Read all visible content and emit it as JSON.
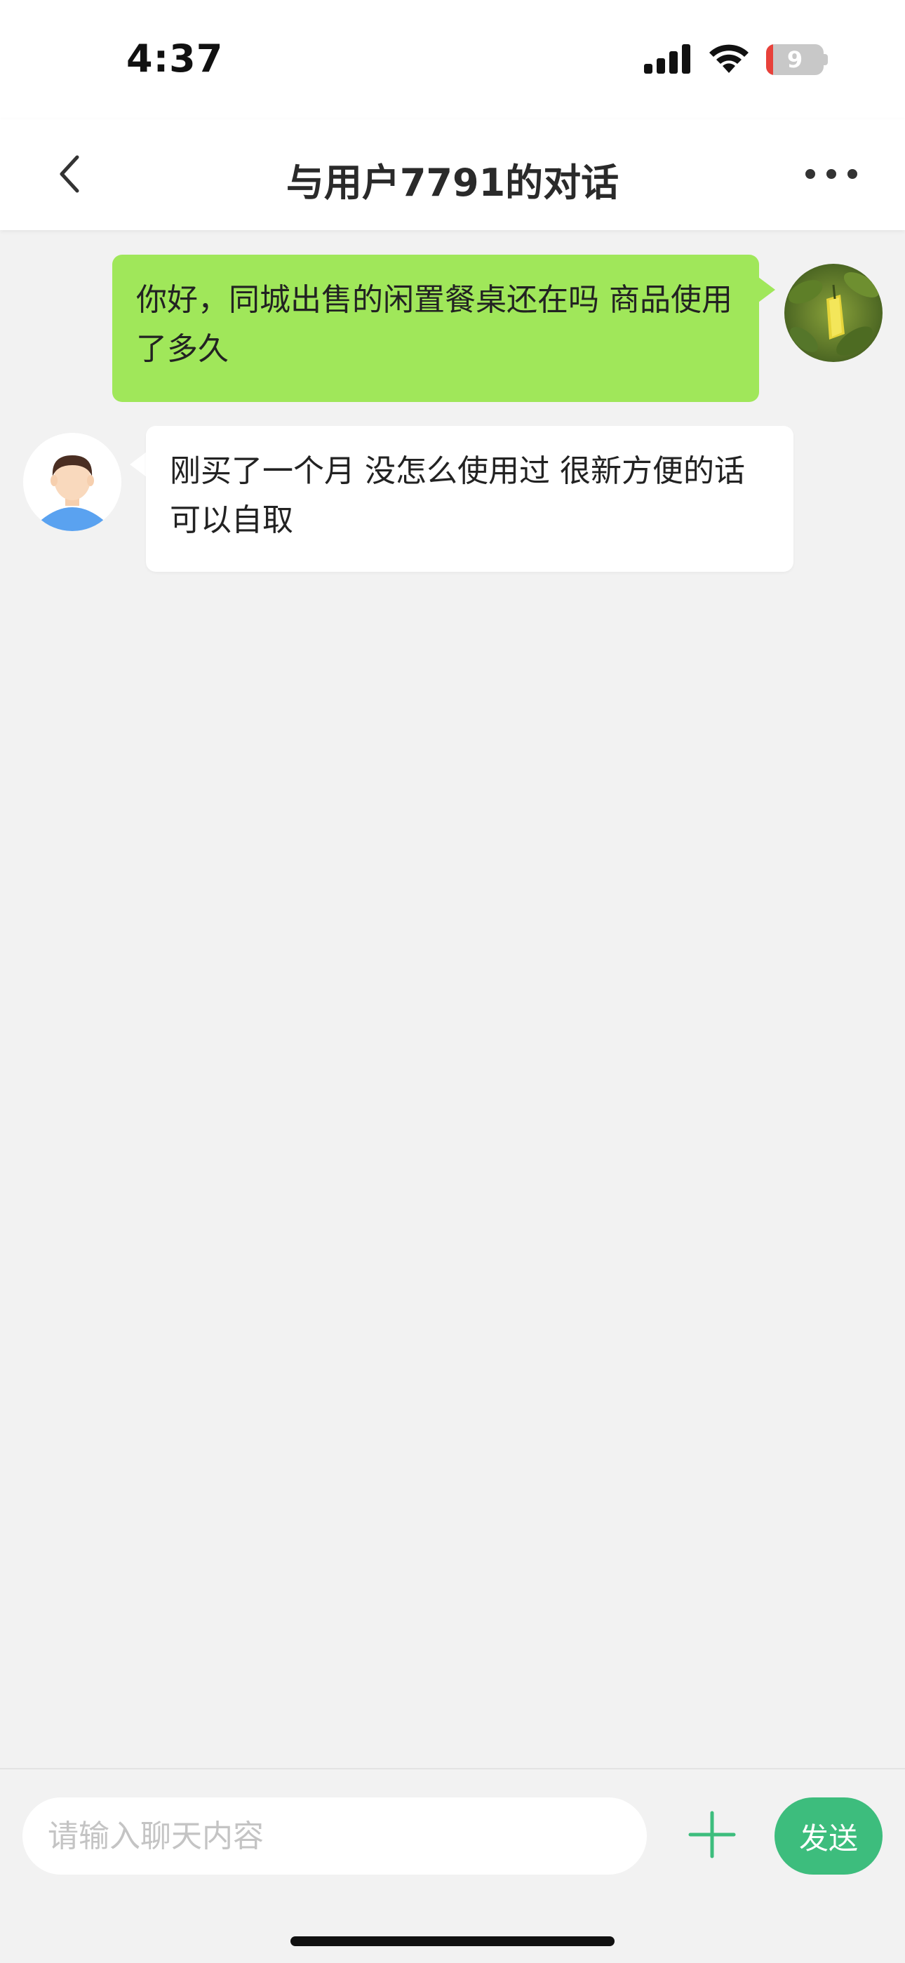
{
  "status_bar": {
    "time": "4:37",
    "battery_level": "9"
  },
  "header": {
    "title": "与用户7791的对话"
  },
  "messages": [
    {
      "direction": "outgoing",
      "text": "你好，同城出售的闲置餐桌还在吗 商品使用了多久",
      "bubble_color": "#a0e75a"
    },
    {
      "direction": "incoming",
      "text": "刚买了一个月 没怎么使用过 很新方便的话可以自取",
      "bubble_color": "#ffffff"
    }
  ],
  "composer": {
    "placeholder": "请输入聊天内容",
    "send_label": "发送",
    "send_color": "#3dbd7d",
    "add_icon": "plus-icon"
  },
  "colors": {
    "background": "#f2f2f2",
    "accent": "#3dbd7d",
    "battery_low": "#e8413a"
  }
}
